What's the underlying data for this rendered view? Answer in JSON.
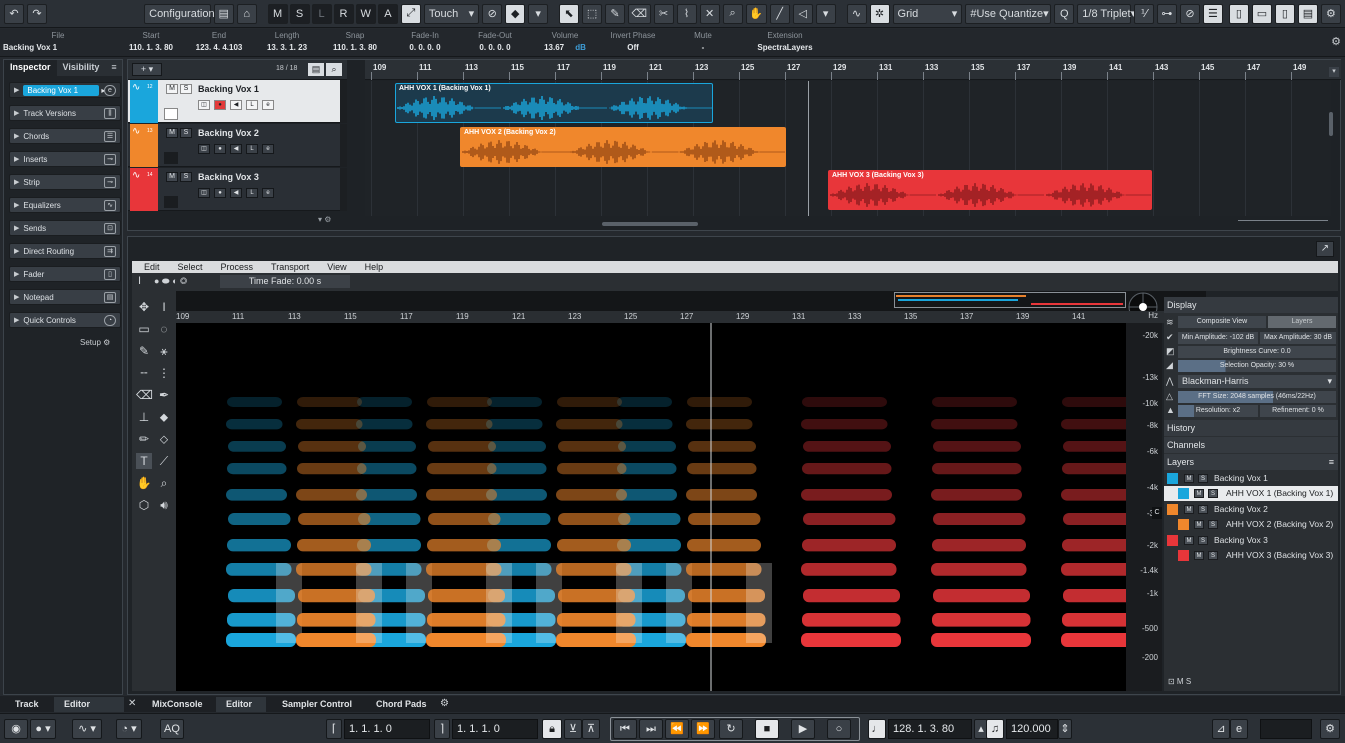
{
  "toolbar": {
    "undo": "↶",
    "redo": "↷",
    "configurations": "Configurations",
    "modes": [
      "M",
      "S",
      "L",
      "R",
      "W",
      "A"
    ],
    "automation_mode": "Touch",
    "grid_type": "Grid",
    "quantize_mode": "Use Quantize",
    "quantize_value": "1/8 Triplet"
  },
  "infoline": {
    "file_label": "File",
    "file_value": "Backing Vox 1",
    "start_label": "Start",
    "start_value": "110. 1. 3. 80",
    "end_label": "End",
    "end_value": "123. 4. 4.103",
    "length_label": "Length",
    "length_value": "13. 3. 1. 23",
    "snap_label": "Snap",
    "snap_value": "110. 1. 3. 80",
    "fadein_label": "Fade-In",
    "fadein_value": "0. 0. 0. 0",
    "fadeout_label": "Fade-Out",
    "fadeout_value": "0. 0. 0. 0",
    "volume_label": "Volume",
    "volume_value": "13.67",
    "volume_unit": "dB",
    "invert_label": "Invert Phase",
    "invert_value": "Off",
    "mute_label": "Mute",
    "mute_value": "-",
    "extension_label": "Extension",
    "extension_value": "SpectraLayers"
  },
  "inspector": {
    "tab_inspector": "Inspector",
    "tab_visibility": "Visibility",
    "track_name": "Backing Vox 1",
    "sections": [
      "Track Versions",
      "Chords",
      "Inserts",
      "Strip",
      "Equalizers",
      "Sends",
      "Direct Routing",
      "Fader",
      "Notepad",
      "Quick Controls"
    ],
    "setup": "Setup"
  },
  "project": {
    "track_count": "18 / 18",
    "tracks": [
      {
        "name": "Backing Vox 1",
        "color": "#1aa6dc"
      },
      {
        "name": "Backing Vox 2",
        "color": "#f0872c"
      },
      {
        "name": "Backing Vox 3",
        "color": "#e8363a"
      }
    ],
    "ruler": [
      "109",
      "111",
      "113",
      "115",
      "117",
      "119",
      "121",
      "123",
      "125",
      "127",
      "129",
      "131",
      "133",
      "135",
      "137",
      "139",
      "141",
      "143",
      "145",
      "147",
      "149"
    ],
    "events": [
      {
        "name": "AHH VOX 1 (Backing Vox 1)"
      },
      {
        "name": "AHH VOX 2 (Backing Vox 2)"
      },
      {
        "name": "AHH VOX 3 (Backing Vox 3)"
      }
    ]
  },
  "spectralayers": {
    "menu": [
      "Edit",
      "Select",
      "Process",
      "Transport",
      "View",
      "Help"
    ],
    "time_fade": "Time Fade: 0.00 s",
    "ruler": [
      "109",
      "111",
      "113",
      "115",
      "117",
      "119",
      "121",
      "123",
      "125",
      "127",
      "129",
      "131",
      "133",
      "135",
      "137",
      "139",
      "141"
    ],
    "freq_unit": "Hz",
    "freq_ticks": [
      "20k",
      "13k",
      "10k",
      "8k",
      "6k",
      "4k",
      "3k",
      "2k",
      "1.4k",
      "1k",
      "500",
      "200"
    ],
    "display_header": "Display",
    "composite_view": "Composite View",
    "layers_btn": "Layers",
    "min_amplitude": "Min Amplitude: -102 dB",
    "max_amplitude": "Max Amplitude: 30 dB",
    "brightness_curve": "Brightness Curve: 0.0",
    "selection_opacity": "Selection Opacity: 30 %",
    "window_fn": "Blackman-Harris",
    "fft_size": "FFT Size: 2048 samples (46ms/22Hz)",
    "resolution": "Resolution: x2",
    "refinement": "Refinement: 0 %",
    "history": "History",
    "channels": "Channels",
    "layers_header": "Layers",
    "layers": [
      {
        "name": "Backing Vox 1",
        "child": "AHH VOX 1 (Backing Vox 1)"
      },
      {
        "name": "Backing Vox 2",
        "child": "AHH VOX 2 (Backing Vox 2)"
      },
      {
        "name": "Backing Vox 3",
        "child": "AHH VOX 3 (Backing Vox 3)"
      }
    ]
  },
  "bottom_tabs": {
    "track": "Track",
    "editor": "Editor",
    "mixconsole": "MixConsole",
    "editor2": "Editor",
    "sampler": "Sampler Control",
    "chordpads": "Chord Pads"
  },
  "transport": {
    "aq": "AQ",
    "left_locator": "1. 1. 1.  0",
    "right_locator": "1. 1. 1.  0",
    "position": "128. 1. 3. 80",
    "tempo": "120.000"
  },
  "colors": {
    "blue": "#1aa6dc",
    "orange": "#f0872c",
    "red": "#e8363a"
  }
}
